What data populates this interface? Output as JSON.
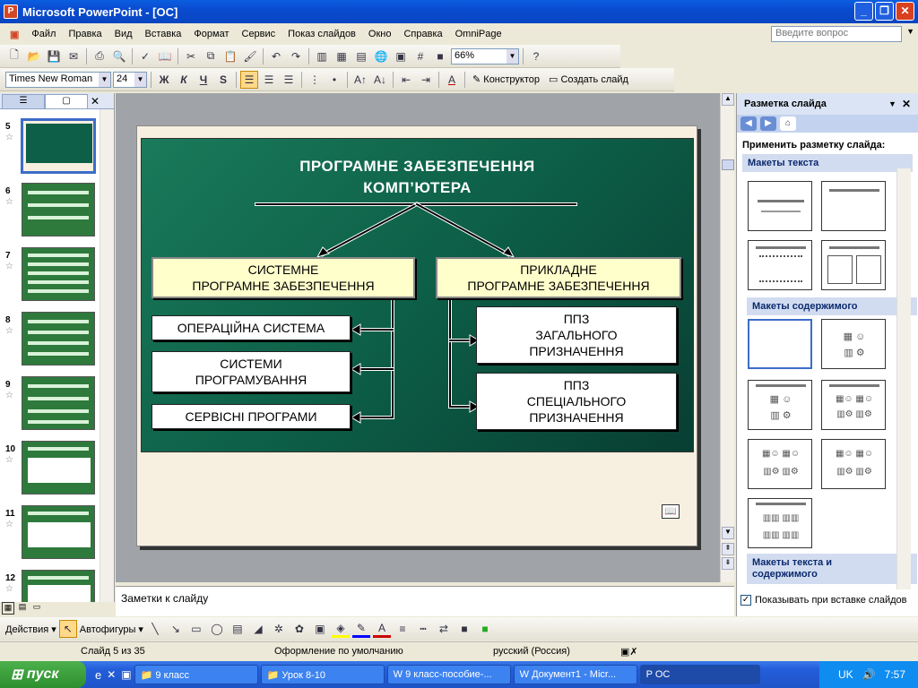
{
  "window": {
    "title": "Microsoft PowerPoint - [ОС]"
  },
  "menu": [
    "Файл",
    "Правка",
    "Вид",
    "Вставка",
    "Формат",
    "Сервис",
    "Показ слайдов",
    "Окно",
    "Справка",
    "OmniPage"
  ],
  "help_placeholder": "Введите вопрос",
  "toolbar": {
    "zoom": "66%"
  },
  "format_toolbar": {
    "font": "Times New Roman",
    "size": "24",
    "bold": "Ж",
    "italic": "К",
    "underline": "Ч",
    "shadow": "S",
    "designer": "Конструктор",
    "new_slide": "Создать слайд"
  },
  "thumbnails": [
    {
      "num": "5"
    },
    {
      "num": "6"
    },
    {
      "num": "7"
    },
    {
      "num": "8"
    },
    {
      "num": "9"
    },
    {
      "num": "10"
    },
    {
      "num": "11"
    },
    {
      "num": "12"
    }
  ],
  "slide": {
    "title_line1": "ПРОГРАМНЕ ЗАБЕЗПЕЧЕННЯ",
    "title_line2": "КОМП’ЮТЕРА",
    "system_sw_l1": "СИСТЕМНЕ",
    "system_sw_l2": "ПРОГРАМНЕ ЗАБЕЗПЕЧЕННЯ",
    "applied_sw_l1": "ПРИКЛАДНЕ",
    "applied_sw_l2": "ПРОГРАМНЕ ЗАБЕЗПЕЧЕННЯ",
    "os": "ОПЕРАЦІЙНА СИСТЕМА",
    "prog_l1": "СИСТЕМИ",
    "prog_l2": "ПРОГРАМУВАННЯ",
    "service": "СЕРВІСНІ ПРОГРАМИ",
    "general_l1": "ППЗ",
    "general_l2": "ЗАГАЛЬНОГО",
    "general_l3": "ПРИЗНАЧЕННЯ",
    "special_l1": "ППЗ",
    "special_l2": "СПЕЦІАЛЬНОГО",
    "special_l3": "ПРИЗНАЧЕННЯ"
  },
  "notes_placeholder": "Заметки к слайду",
  "taskpane": {
    "title": "Разметка слайда",
    "apply": "Применить разметку слайда:",
    "section_text": "Макеты текста",
    "section_content": "Макеты содержимого",
    "section_text_content_l1": "Макеты текста и",
    "section_text_content_l2": "содержимого",
    "show_on_insert": "Показывать при вставке слайдов"
  },
  "drawbar": {
    "actions": "Действия",
    "autoshapes": "Автофигуры"
  },
  "status": {
    "slide": "Слайд 5 из 35",
    "design": "Оформление по умолчанию",
    "lang": "русский (Россия)"
  },
  "taskbar": {
    "start": "пуск",
    "tasks": [
      "9 класс",
      "Урок 8-10",
      "9 класс-пособие-...",
      "Документ1 - Micr...",
      "ОС"
    ],
    "lang": "UK",
    "time": "7:57"
  }
}
